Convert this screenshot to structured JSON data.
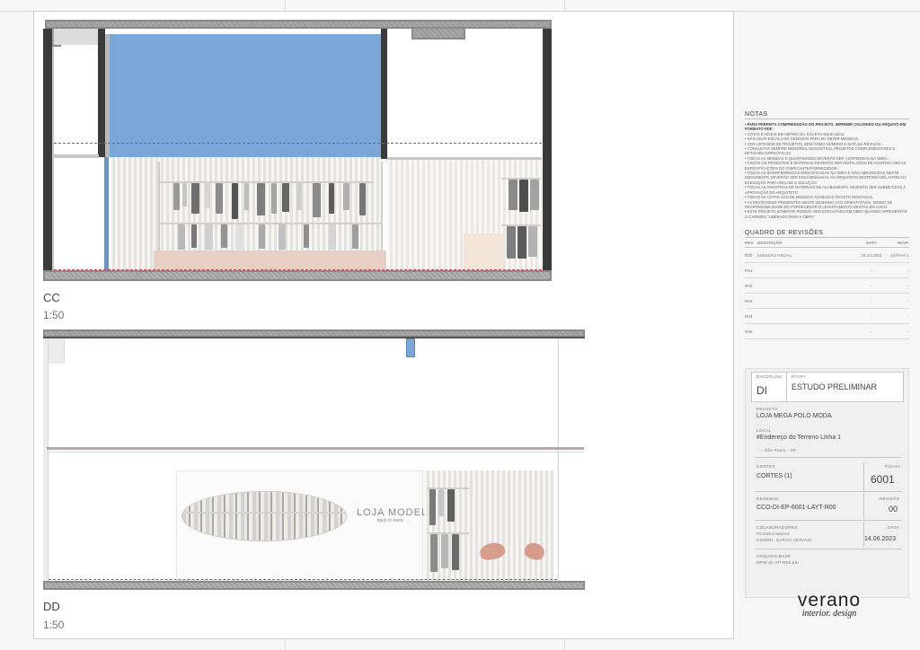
{
  "sections": {
    "cc": {
      "label": "CC",
      "scale": "1:50"
    },
    "dd": {
      "label": "DD",
      "scale": "1:50",
      "sign_title": "LOJA MODELO",
      "sign_subtitle": "back to basic"
    }
  },
  "notes": {
    "title": "NOTAS",
    "items": [
      "• PARA PERFEITA COMPREENSÃO DO PROJETO, IMPRIMIR COLORIDO OU ARQUIVO EM FORMATO PDF;",
      "• COTAS E NÍVEIS EM METRO (m), EXCETO INDICADAS.",
      "• NÃO USAR ESCALA NO DESENHO PARA SE OBTER MEDIDAS.",
      "• VER LISTAGEM DE PROJETOS, BEM COMO NÚMERO E DATA DA REVISÃO.",
      "• CONSULTAR SEMPRE MEMORIAL DESCRITIVO, PROJETOS COMPLEMENTARES E DETALHES ESPECÍFICOS.",
      "• TODAS AS MEDIDAS E QUANTIDADES DEVERÃO SER CONFERIDAS NA OBRA.",
      "• TODOS OS PRODUTOS E MATERIAIS DEVERÃO SER INSTALADOS DE ACORDO COM AS ESPECIFICAÇÕES DO FABRICANTE/FORNECEDOR.",
      "• TODAS AS INTERFERÊNCIAS IDENTIFICADAS NA OBRA E NÃO ABRANGIDAS NESTE DOCUMENTO DEVERÃO SER ENCAMINHADAS AO ARQUITETO RESPONSÁVEL ANTES DA EXECUÇÃO PARA ANÁLISE E SOLUÇÃO.",
      "• TODAS AS AMOSTRAS DE MATERIAIS DE ACABAMENTO DEVERÃO SER SUBMETIDAS À APROVAÇÃO DO ARQUITETO.",
      "• TODAS AS COTAS SÃO DE MEDIDAS ACABADAS EXCETO INDICADAS.",
      "• AS METRAGENS PRESENTES NESTE DESENHO SÃO ORIENTATIVAS, SENDO DE RESPONSABILIDADE DO FORNECEDOR O LEVANTAMENTO DESTAS EM LOCO.",
      "• ESTE PROJETO SOMENTE PODERÁ SER EXECUTADO EM OBRA QUANDO APRESENTAR O CARIMBO \"LIBERADO PARA A OBRA\""
    ]
  },
  "revisions": {
    "title": "QUADRO DE REVISÕES",
    "headers": {
      "rev": "REV.",
      "desc": "DESCRIÇÃO",
      "date": "DATA",
      "resp": "RESP."
    },
    "rows": [
      {
        "rev": "R00",
        "desc": "EMISSÃO INICIAL",
        "date": "24.03.2023",
        "resp": "SARAH V."
      },
      {
        "rev": "R01",
        "desc": "",
        "date": "-",
        "resp": "-"
      },
      {
        "rev": "R02",
        "desc": "",
        "date": "-",
        "resp": "-"
      },
      {
        "rev": "R03",
        "desc": "",
        "date": "-",
        "resp": "-"
      },
      {
        "rev": "R04",
        "desc": "",
        "date": "-",
        "resp": "-"
      },
      {
        "rev": "R05",
        "desc": "",
        "date": "-",
        "resp": "-"
      }
    ]
  },
  "stamp": {
    "disciplina_label": "DISCIPLINA",
    "disciplina": "DI",
    "etapa_label": "ETAPA",
    "etapa": "ESTUDO PRELIMINAR",
    "projeto_label": "PROJETO",
    "projeto": "LOJA MEGA POLO MODA",
    "local_label": "LOCAL",
    "local_line1": "#Endereço do Terreno Linha 1",
    "local_line2": "- - São Paulo - SP",
    "cortes_label": "CORTES",
    "cortes": "CORTES (1)",
    "folha_label": "FOLHA",
    "folha": "6001",
    "desenho_label": "DESENHO",
    "desenho": "CCO-DI-EP-6001-LAYT-R00",
    "revisao_label": "REVISÃO",
    "revisao": "00",
    "colaboradores_label": "COLABORADORES",
    "colaboradores_line1": "#Colaboradores",
    "colaboradores_line2": "COORD. SARAH VERANO",
    "data_label": "DATA",
    "data": "14.06.2023",
    "arquivo_label": "ARQUIVO BASE",
    "arquivo": "MPM-DI-AP-R05.pln"
  },
  "logo": {
    "name": "verano",
    "tagline": "interior. design"
  },
  "colors": {
    "accent_blue": "#7aa7d7",
    "dash_red": "#d0434b",
    "wood_pink": "#e7cfc3"
  }
}
